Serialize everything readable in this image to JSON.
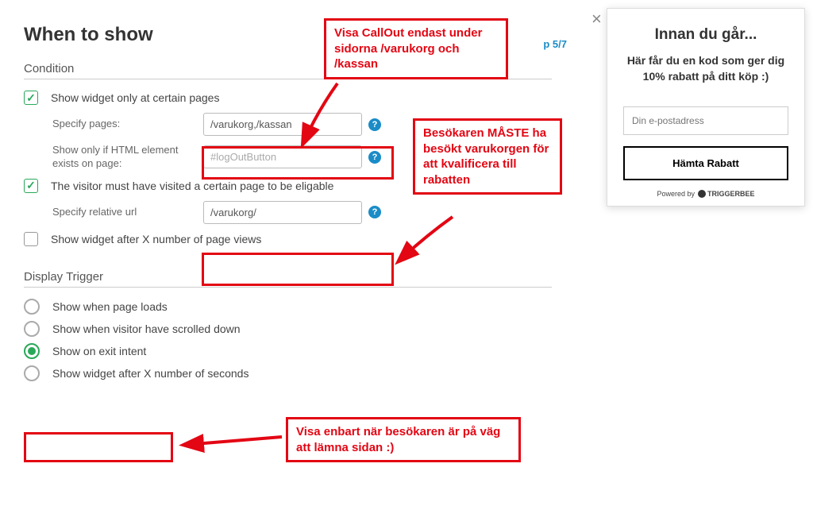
{
  "header": {
    "title": "When to show",
    "step": "p 5/7"
  },
  "condition": {
    "section_title": "Condition",
    "certain_pages": {
      "label": "Show widget only at certain pages",
      "specify_label": "Specify pages:",
      "specify_value": "/varukorg,/kassan",
      "html_label": "Show only if HTML element exists on page:",
      "html_placeholder": "#logOutButton"
    },
    "must_visit": {
      "label": "The visitor must have visited a certain page to be eligable",
      "specify_label": "Specify relative url",
      "specify_value": "/varukorg/"
    },
    "page_views": {
      "label": "Show widget after X number of page views"
    }
  },
  "display_trigger": {
    "section_title": "Display Trigger",
    "opt_load": "Show when page loads",
    "opt_scroll": "Show when visitor have scrolled down",
    "opt_exit": "Show on exit intent",
    "opt_secs": "Show widget after X number of seconds"
  },
  "annotations": {
    "a1": "Visa CallOut endast under sidorna /varukorg och /kassan",
    "a2": "Besökaren MÅSTE ha besökt varukorgen för att kvalificera till rabatten",
    "a3": "Visa enbart när besökaren är på väg att lämna sidan :)"
  },
  "popup": {
    "title": "Innan du går...",
    "text": "Här får du en kod som ger dig 10% rabatt på ditt köp :)",
    "email_placeholder": "Din e-postadress",
    "button": "Hämta Rabatt",
    "powered": "Powered by",
    "brand": "TRIGGERBEE"
  }
}
